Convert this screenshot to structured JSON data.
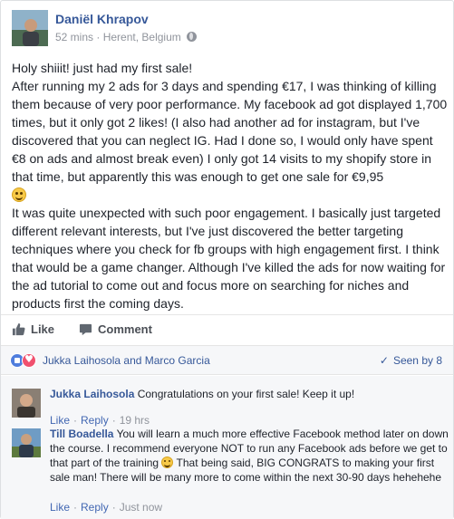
{
  "post": {
    "author": "Daniël Khrapov",
    "time": "52 mins",
    "location": "Herent, Belgium",
    "meta_separator": "·",
    "paragraph1_a": "Holy shiiit! just had my first sale!",
    "paragraph1_b": "After running my 2 ads for 3 days and spending €17, I was thinking of killing them because of very poor performance. My facebook ad got displayed 1,700 times, but it only got 2 likes! (I also had another ad for instagram, but I've discovered that you can neglect IG. Had I done so, I would only have spent €8 on ads and almost break even) I only got 14 visits to my shopify store in that time, but apparently this was enough to get one sale for €9,95",
    "paragraph2": "It was quite unexpected with such poor engagement. I basically just targeted different relevant interests, but I've just discovered the better targeting techniques where you check for fb groups with high engagement first. I think that would be a game changer. Although I've killed the ads for now waiting for the ad tutorial to come out and focus more on searching for niches and products first the coming days."
  },
  "actions": {
    "like_label": "Like",
    "comment_label": "Comment"
  },
  "reactions": {
    "names": "Jukka Laihosola and Marco Garcia",
    "seen_label": "Seen by 8"
  },
  "comments": [
    {
      "name": "Jukka Laihosola",
      "text": "Congratulations on your first sale! Keep it up!",
      "like": "Like",
      "reply": "Reply",
      "time": "19 hrs"
    },
    {
      "name": "Till Boadella",
      "text_a": "You will learn a much more effective Facebook method later on down the course. I recommend everyone NOT to run any Facebook ads before we get to that part of the training",
      "text_b": "That being said, BIG CONGRATS to making your first sale man! There will be many more to come within the next 30-90 days hehehehe",
      "like": "Like",
      "reply": "Reply",
      "time": "Just now"
    }
  ],
  "colors": {
    "link_blue": "#365899",
    "meta_gray": "#90949c",
    "panel_bg": "#f6f7f9"
  }
}
